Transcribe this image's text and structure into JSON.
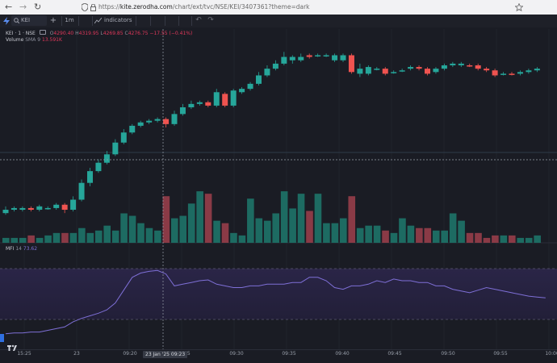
{
  "browser": {
    "url_prefix": "https://",
    "url_domain": "kite.zerodha.com",
    "url_path": "/chart/ext/tvc/NSE/KEI/3407361?theme=dark"
  },
  "toolbar": {
    "symbol": "KEI",
    "add_label": "+",
    "interval": "1m",
    "indicators_label": "indicators"
  },
  "legend": {
    "symbol_line": "KEI · 1 · NSE",
    "open_label": "O",
    "open": "4290.40",
    "high_label": "H",
    "high": "4319.95",
    "low_label": "L",
    "low": "4269.85",
    "close_label": "C",
    "close": "4276.75",
    "change": "−17.55 (−0.41%)",
    "volume_label": "Volume",
    "volume_sma_label": "SMA 9",
    "volume_sma": "13.591K",
    "mfi_label": "MFI",
    "mfi_period": "14",
    "mfi_value": "73.62"
  },
  "crosshair_label": "23 Jan '25 09:23",
  "x_axis_labels": [
    "15:25",
    "23",
    "09:20",
    "09:25",
    "09:30",
    "09:35",
    "09:40",
    "09:45",
    "09:50",
    "09:55",
    "10:00"
  ],
  "colors": {
    "up": "#26a69a",
    "down": "#ef5350",
    "mfi": "#7e6fd6"
  },
  "chart_data": {
    "type": "candlestick",
    "candles": [
      {
        "o": 4250,
        "c": 4252,
        "h": 4254,
        "l": 4249,
        "v": 2,
        "up": true
      },
      {
        "o": 4252,
        "c": 4253,
        "h": 4254,
        "l": 4251,
        "v": 2,
        "up": true
      },
      {
        "o": 4252,
        "c": 4253,
        "h": 4254,
        "l": 4251,
        "v": 2,
        "up": true
      },
      {
        "o": 4253,
        "c": 4252,
        "h": 4254,
        "l": 4251,
        "v": 3,
        "up": false
      },
      {
        "o": 4252,
        "c": 4254,
        "h": 4255,
        "l": 4251,
        "v": 2,
        "up": true
      },
      {
        "o": 4253,
        "c": 4253,
        "h": 4254,
        "l": 4252,
        "v": 3,
        "up": true
      },
      {
        "o": 4253,
        "c": 4255,
        "h": 4256,
        "l": 4252,
        "v": 4,
        "up": true
      },
      {
        "o": 4255,
        "c": 4252,
        "h": 4256,
        "l": 4250,
        "v": 4,
        "up": false
      },
      {
        "o": 4252,
        "c": 4258,
        "h": 4260,
        "l": 4251,
        "v": 4,
        "up": true
      },
      {
        "o": 4258,
        "c": 4268,
        "h": 4270,
        "l": 4257,
        "v": 6,
        "up": true
      },
      {
        "o": 4268,
        "c": 4275,
        "h": 4277,
        "l": 4266,
        "v": 4,
        "up": true
      },
      {
        "o": 4275,
        "c": 4280,
        "h": 4282,
        "l": 4274,
        "v": 5,
        "up": true
      },
      {
        "o": 4280,
        "c": 4285,
        "h": 4287,
        "l": 4279,
        "v": 7,
        "up": true
      },
      {
        "o": 4285,
        "c": 4292,
        "h": 4294,
        "l": 4284,
        "v": 5,
        "up": true
      },
      {
        "o": 4292,
        "c": 4298,
        "h": 4300,
        "l": 4291,
        "v": 12,
        "up": true
      },
      {
        "o": 4298,
        "c": 4302,
        "h": 4303,
        "l": 4297,
        "v": 11,
        "up": true
      },
      {
        "o": 4302,
        "c": 4304,
        "h": 4305,
        "l": 4301,
        "v": 8,
        "up": true
      },
      {
        "o": 4304,
        "c": 4305,
        "h": 4306,
        "l": 4303,
        "v": 6,
        "up": true
      },
      {
        "o": 4305,
        "c": 4306,
        "h": 4307,
        "l": 4304,
        "v": 5,
        "up": true
      },
      {
        "o": 4306,
        "c": 4303,
        "h": 4307,
        "l": 4301,
        "v": 19,
        "up": false
      },
      {
        "o": 4303,
        "c": 4309,
        "h": 4311,
        "l": 4302,
        "v": 10,
        "up": true
      },
      {
        "o": 4309,
        "c": 4313,
        "h": 4315,
        "l": 4308,
        "v": 11,
        "up": true
      },
      {
        "o": 4313,
        "c": 4315,
        "h": 4317,
        "l": 4312,
        "v": 16,
        "up": true
      },
      {
        "o": 4315,
        "c": 4316,
        "h": 4317,
        "l": 4314,
        "v": 21,
        "up": true
      },
      {
        "o": 4316,
        "c": 4314,
        "h": 4317,
        "l": 4313,
        "v": 20,
        "up": false
      },
      {
        "o": 4314,
        "c": 4322,
        "h": 4324,
        "l": 4313,
        "v": 9,
        "up": true
      },
      {
        "o": 4321,
        "c": 4314,
        "h": 4322,
        "l": 4313,
        "v": 8,
        "up": false
      },
      {
        "o": 4314,
        "c": 4323,
        "h": 4324,
        "l": 4313,
        "v": 4,
        "up": true
      },
      {
        "o": 4322,
        "c": 4324,
        "h": 4325,
        "l": 4321,
        "v": 3,
        "up": true
      },
      {
        "o": 4324,
        "c": 4327,
        "h": 4328,
        "l": 4323,
        "v": 18,
        "up": true
      },
      {
        "o": 4327,
        "c": 4332,
        "h": 4334,
        "l": 4326,
        "v": 10,
        "up": true
      },
      {
        "o": 4332,
        "c": 4336,
        "h": 4338,
        "l": 4331,
        "v": 9,
        "up": true
      },
      {
        "o": 4336,
        "c": 4339,
        "h": 4341,
        "l": 4335,
        "v": 12,
        "up": true
      },
      {
        "o": 4339,
        "c": 4343,
        "h": 4346,
        "l": 4338,
        "v": 21,
        "up": true
      },
      {
        "o": 4343,
        "c": 4341,
        "h": 4344,
        "l": 4339,
        "v": 14,
        "up": true
      },
      {
        "o": 4341,
        "c": 4343,
        "h": 4345,
        "l": 4340,
        "v": 20,
        "up": true
      },
      {
        "o": 4343,
        "c": 4344,
        "h": 4345,
        "l": 4342,
        "v": 13,
        "up": false
      },
      {
        "o": 4344,
        "c": 4344,
        "h": 4345,
        "l": 4343,
        "v": 20,
        "up": true
      },
      {
        "o": 4344,
        "c": 4344,
        "h": 4345,
        "l": 4343,
        "v": 8,
        "up": true
      },
      {
        "o": 4344,
        "c": 4341,
        "h": 4345,
        "l": 4340,
        "v": 8,
        "up": true
      },
      {
        "o": 4341,
        "c": 4344,
        "h": 4345,
        "l": 4340,
        "v": 10,
        "up": true
      },
      {
        "o": 4344,
        "c": 4334,
        "h": 4345,
        "l": 4333,
        "v": 19,
        "up": false
      },
      {
        "o": 4336,
        "c": 4333,
        "h": 4339,
        "l": 4331,
        "v": 6,
        "up": true
      },
      {
        "o": 4333,
        "c": 4337,
        "h": 4338,
        "l": 4332,
        "v": 7,
        "up": true
      },
      {
        "o": 4336,
        "c": 4336,
        "h": 4337,
        "l": 4335,
        "v": 7,
        "up": true
      },
      {
        "o": 4336,
        "c": 4333,
        "h": 4337,
        "l": 4332,
        "v": 5,
        "up": false
      },
      {
        "o": 4334,
        "c": 4334,
        "h": 4335,
        "l": 4333,
        "v": 4,
        "up": true
      },
      {
        "o": 4335,
        "c": 4335,
        "h": 4336,
        "l": 4334,
        "v": 10,
        "up": true
      },
      {
        "o": 4336,
        "c": 4337,
        "h": 4338,
        "l": 4335,
        "v": 7,
        "up": true
      },
      {
        "o": 4337,
        "c": 4336,
        "h": 4338,
        "l": 4335,
        "v": 6,
        "up": false
      },
      {
        "o": 4336,
        "c": 4333,
        "h": 4337,
        "l": 4332,
        "v": 6,
        "up": false
      },
      {
        "o": 4334,
        "c": 4336,
        "h": 4337,
        "l": 4333,
        "v": 5,
        "up": true
      },
      {
        "o": 4336,
        "c": 4338,
        "h": 4339,
        "l": 4335,
        "v": 5,
        "up": true
      },
      {
        "o": 4338,
        "c": 4339,
        "h": 4340,
        "l": 4337,
        "v": 12,
        "up": true
      },
      {
        "o": 4339,
        "c": 4338,
        "h": 4340,
        "l": 4337,
        "v": 9,
        "up": true
      },
      {
        "o": 4338,
        "c": 4338,
        "h": 4339,
        "l": 4337,
        "v": 4,
        "up": false
      },
      {
        "o": 4338,
        "c": 4336,
        "h": 4339,
        "l": 4335,
        "v": 4,
        "up": false
      },
      {
        "o": 4336,
        "c": 4335,
        "h": 4337,
        "l": 4334,
        "v": 2,
        "up": false
      },
      {
        "o": 4335,
        "c": 4332,
        "h": 4336,
        "l": 4331,
        "v": 3,
        "up": false
      },
      {
        "o": 4333,
        "c": 4333,
        "h": 4334,
        "l": 4332,
        "v": 3,
        "up": true
      },
      {
        "o": 4333,
        "c": 4333,
        "h": 4334,
        "l": 4332,
        "v": 3,
        "up": false
      },
      {
        "o": 4333,
        "c": 4334,
        "h": 4335,
        "l": 4332,
        "v": 2,
        "up": true
      },
      {
        "o": 4334,
        "c": 4335,
        "h": 4336,
        "l": 4333,
        "v": 2,
        "up": true
      },
      {
        "o": 4335,
        "c": 4336,
        "h": 4337,
        "l": 4334,
        "v": 3,
        "up": true
      }
    ],
    "mfi": [
      4,
      5,
      5,
      6,
      6,
      8,
      10,
      12,
      18,
      22,
      25,
      28,
      32,
      40,
      55,
      70,
      75,
      77,
      78,
      74,
      60,
      62,
      64,
      66,
      67,
      62,
      60,
      58,
      58,
      60,
      60,
      62,
      62,
      62,
      64,
      64,
      70,
      70,
      66,
      58,
      56,
      60,
      60,
      62,
      66,
      64,
      68,
      66,
      66,
      64,
      64,
      60,
      60,
      56,
      54,
      52,
      55,
      58,
      56,
      54,
      52,
      50,
      48,
      47,
      46
    ],
    "mfi_levels": [
      80,
      20
    ]
  }
}
